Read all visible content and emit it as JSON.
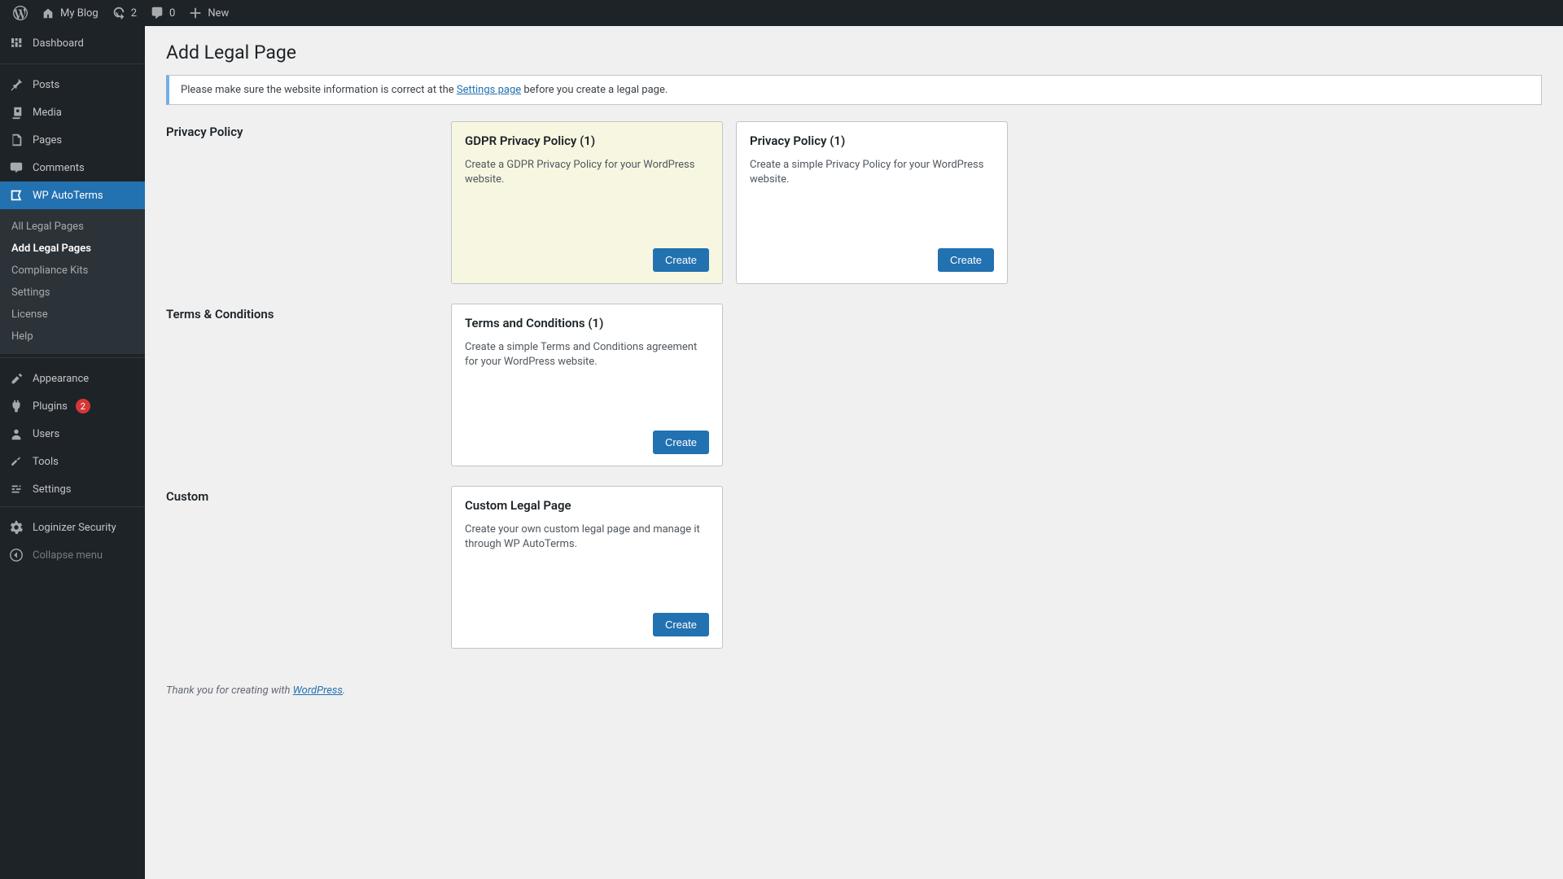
{
  "adminbar": {
    "site_name": "My Blog",
    "updates_count": "2",
    "comments_count": "0",
    "new_label": "New"
  },
  "sidebar": {
    "dashboard": "Dashboard",
    "posts": "Posts",
    "media": "Media",
    "pages": "Pages",
    "comments": "Comments",
    "autoterms": "WP AutoTerms",
    "appearance": "Appearance",
    "plugins": "Plugins",
    "plugins_badge": "2",
    "users": "Users",
    "tools": "Tools",
    "settings": "Settings",
    "loginizer": "Loginizer Security",
    "collapse": "Collapse menu"
  },
  "submenu": {
    "all_legal": "All Legal Pages",
    "add_legal": "Add Legal Pages",
    "compliance": "Compliance Kits",
    "settings": "Settings",
    "license": "License",
    "help": "Help"
  },
  "page": {
    "title": "Add Legal Page",
    "notice_pre": "Please make sure the website information is correct at the ",
    "notice_link": "Settings page",
    "notice_post": " before you create a legal page."
  },
  "sections": [
    {
      "label": "Privacy Policy",
      "cards": [
        {
          "title": "GDPR Privacy Policy (1)",
          "desc": "Create a GDPR Privacy Policy for your WordPress website.",
          "button": "Create",
          "highlight": true
        },
        {
          "title": "Privacy Policy (1)",
          "desc": "Create a simple Privacy Policy for your WordPress website.",
          "button": "Create",
          "highlight": false
        }
      ]
    },
    {
      "label": "Terms & Conditions",
      "cards": [
        {
          "title": "Terms and Conditions (1)",
          "desc": "Create a simple Terms and Conditions agreement for your WordPress website.",
          "button": "Create",
          "highlight": false
        }
      ]
    },
    {
      "label": "Custom",
      "cards": [
        {
          "title": "Custom Legal Page",
          "desc": "Create your own custom legal page and manage it through WP AutoTerms.",
          "button": "Create",
          "highlight": false
        }
      ]
    }
  ],
  "footer": {
    "pre": "Thank you for creating with ",
    "link": "WordPress",
    "post": "."
  }
}
